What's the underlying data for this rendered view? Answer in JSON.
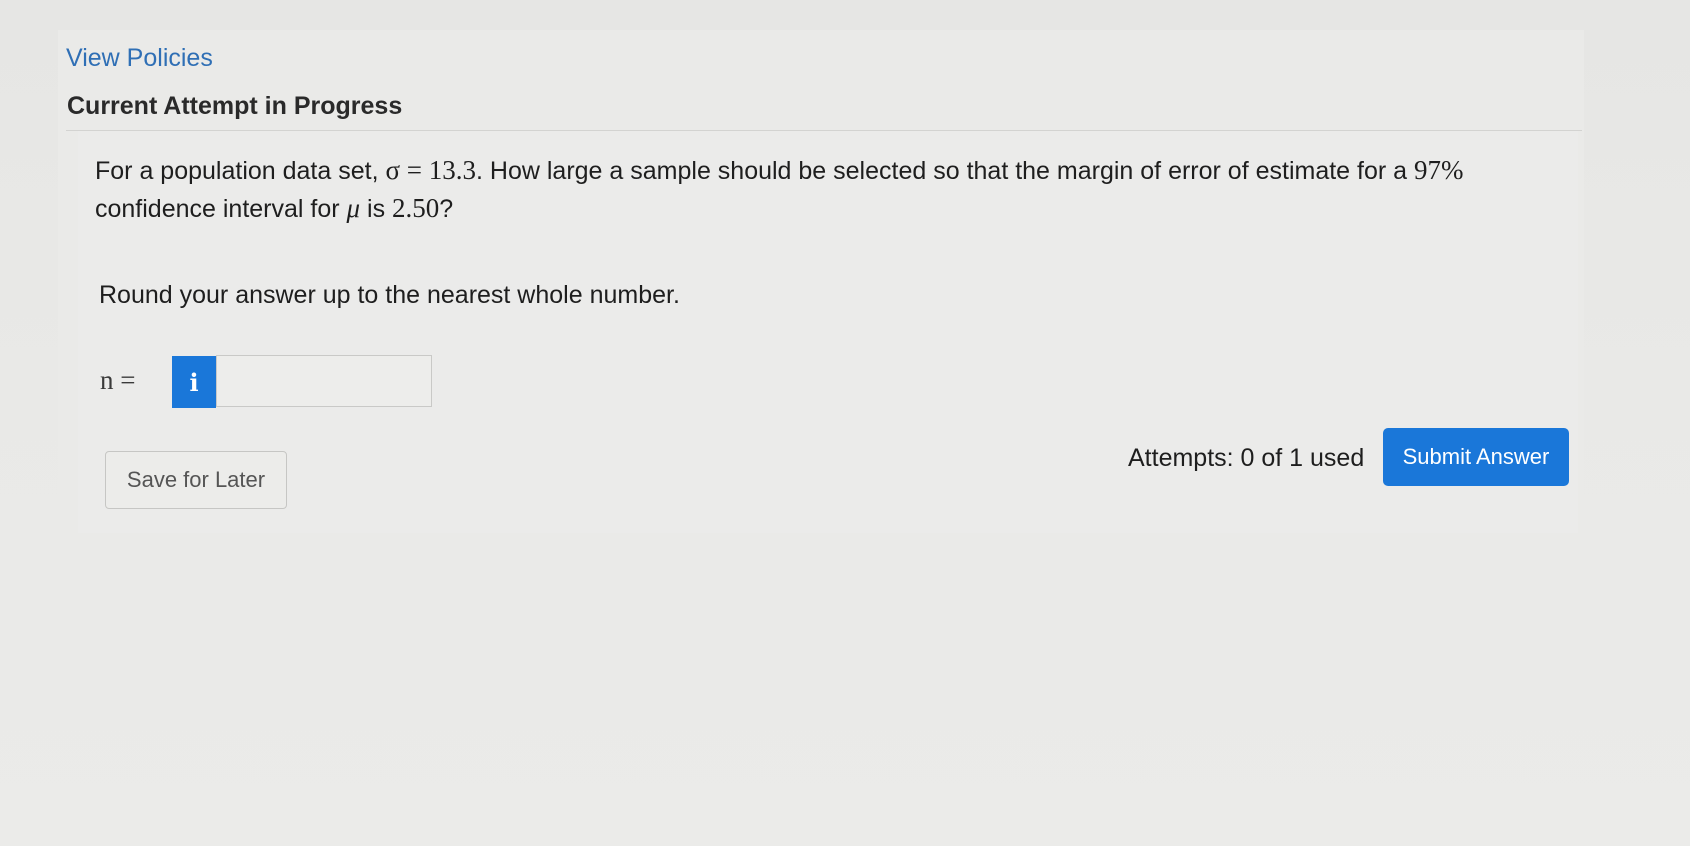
{
  "header": {
    "view_policies_label": "View Policies",
    "attempt_title": "Current Attempt in Progress"
  },
  "question": {
    "prefix": "For a population data set, ",
    "sigma_symbol": "σ",
    "equals": " = ",
    "sigma_value": "13.3",
    "mid": ". How large a sample should be selected so that the margin of error of estimate for a ",
    "confidence": "97%",
    "line2_prefix": " confidence interval for ",
    "mu_symbol": "μ",
    "line2_mid": " is ",
    "margin": "2.50",
    "suffix": "?"
  },
  "instruction": "Round your answer up to the nearest whole number.",
  "answer": {
    "label": "n =",
    "info_icon_glyph": "i",
    "value": "",
    "placeholder": ""
  },
  "footer": {
    "save_label": "Save for Later",
    "attempts_text": "Attempts: 0 of 1 used",
    "submit_label": "Submit Answer"
  },
  "colors": {
    "accent": "#1a77d9",
    "link": "#2f6fb5"
  },
  "icons": {
    "info": "info-icon"
  }
}
